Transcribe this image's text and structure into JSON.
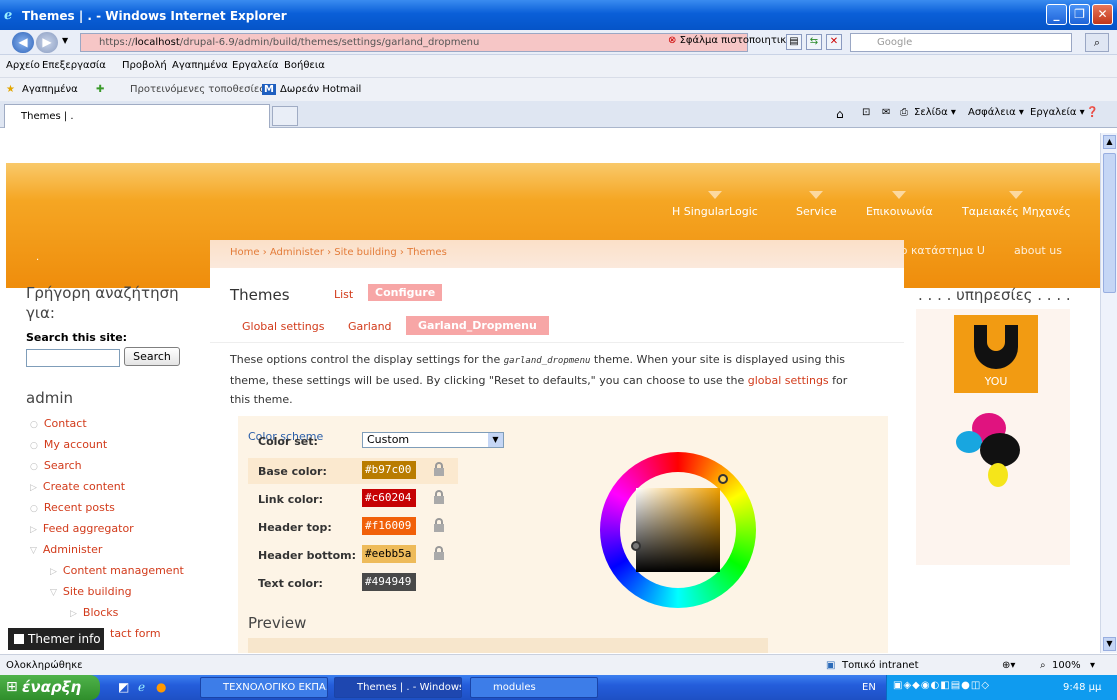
{
  "window": {
    "title": "Themes | . - Windows Internet Explorer"
  },
  "address": {
    "url_prefix": "https://",
    "url_host": "localhost",
    "url_path": "/drupal-6.9/admin/build/themes/settings/garland_dropmenu",
    "cert_error": "Σφάλμα πιστοποιητικού",
    "search_placeholder": "Google"
  },
  "menubar": [
    "Αρχείο",
    "Επεξεργασία",
    "Προβολή",
    "Αγαπημένα",
    "Εργαλεία",
    "Βοήθεια"
  ],
  "favorites": {
    "label": "Αγαπημένα",
    "suggested": "Προτεινόμενες τοποθεσίες ▾",
    "hotmail": "Δωρεάν Hotmail"
  },
  "tabs": {
    "active_label": "Themes | ."
  },
  "commandbar": {
    "page": "Σελίδα ▾",
    "safety": "Ασφάλεια ▾",
    "tools": "Εργαλεία ▾"
  },
  "site": {
    "primary_nav": [
      "Η SingularLogic",
      "Service",
      "Επικοινωνία",
      "Ταμειακές Μηχανές"
    ],
    "secondary_nav": [
      "Το κατάστημα U",
      "about us"
    ],
    "dot": "."
  },
  "breadcrumb": "Home › Administer › Site building › Themes",
  "sidebar_left": {
    "search_title": "Γρήγορη αναζήτηση για:",
    "search_label": "Search this site:",
    "search_button": "Search",
    "admin_title": "admin",
    "nav": [
      {
        "label": "Contact",
        "bullet": "○"
      },
      {
        "label": "My account",
        "bullet": "○"
      },
      {
        "label": "Search",
        "bullet": "○"
      },
      {
        "label": "Create content",
        "bullet": "▷"
      },
      {
        "label": "Recent posts",
        "bullet": "○"
      },
      {
        "label": "Feed aggregator",
        "bullet": "▷"
      },
      {
        "label": "Administer",
        "bullet": "▽"
      },
      {
        "label": "Content management",
        "bullet": "▷"
      },
      {
        "label": "Site building",
        "bullet": "▽"
      },
      {
        "label": "Blocks",
        "bullet": "▷"
      },
      {
        "label": "tact form",
        "bullet": ""
      }
    ]
  },
  "main": {
    "title": "Themes",
    "tabs": [
      "List",
      "Configure"
    ],
    "subtabs": [
      "Global settings",
      "Garland",
      "Garland_Dropmenu"
    ],
    "desc_1": "These options control the display settings for the ",
    "desc_code": "garland_dropmenu",
    "desc_2": " theme. When your site is displayed using this theme, these settings will be used. By clicking \"Reset to defaults,\" you can choose to use the ",
    "desc_link": "global settings",
    "desc_3": " for this theme.",
    "color_scheme_title": "Color scheme",
    "color_set_label": "Color set:",
    "color_set_value": "Custom",
    "fields": [
      {
        "label": "Base color:",
        "value": "#b97c00",
        "color": "#b97c00",
        "text_color": "#ffffff"
      },
      {
        "label": "Link color:",
        "value": "#c60204",
        "color": "#c60204",
        "text_color": "#ffffff"
      },
      {
        "label": "Header top:",
        "value": "#f16009",
        "color": "#f16009",
        "text_color": "#ffffff"
      },
      {
        "label": "Header bottom:",
        "value": "#eebb5a",
        "color": "#eebb5a",
        "text_color": "#000000"
      },
      {
        "label": "Text color:",
        "value": "#494949",
        "color": "#494949",
        "text_color": "#ffffff"
      }
    ],
    "preview_title": "Preview"
  },
  "sidebar_right": {
    "title": ". . . . υπηρεσίες . . . .",
    "logo_text": "YOU"
  },
  "themer_info": "Themer info",
  "status": {
    "left": "Ολοκληρώθηκε",
    "zone": "Τοπικό intranet",
    "zoom": "100%"
  },
  "taskbar": {
    "start": "έναρξη",
    "buttons": [
      "ΤΕΧΝΟΛΟΓΙΚΟ ΕΚΠΑ...",
      "Themes | . - Windows...",
      "modules"
    ],
    "lang": "EN",
    "clock": "9:48 μμ"
  },
  "colors": {
    "accent_link": "#d23b1b",
    "header_orange": "#ef8d0c",
    "breadcrumb_text": "#e37c3a"
  }
}
